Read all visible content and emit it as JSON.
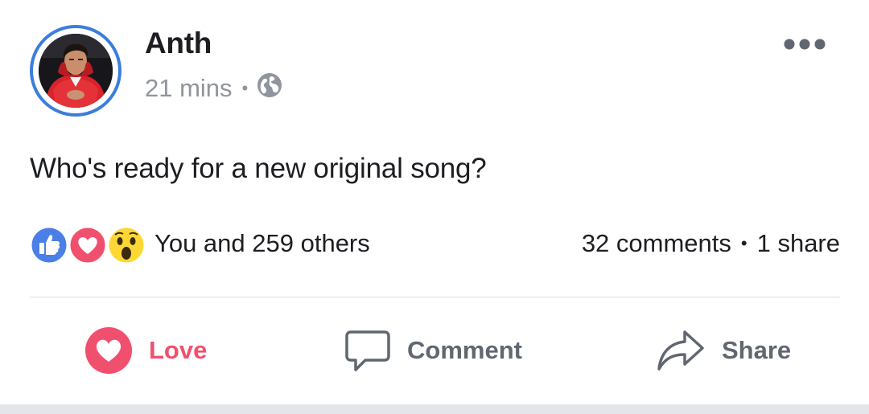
{
  "post": {
    "author": "Anth",
    "time": "21 mins",
    "separator": "•",
    "privacy_icon": "globe-icon",
    "text": "Who's ready for a new original song?",
    "more_icon": "more-options-icon"
  },
  "reactions": {
    "icons": [
      "like-icon",
      "love-icon",
      "wow-icon"
    ],
    "summary": "You and 259 others",
    "comments": "32 comments",
    "separator": "•",
    "shares": "1 share"
  },
  "actions": {
    "love": "Love",
    "comment": "Comment",
    "share": "Share"
  },
  "colors": {
    "like_blue": "#4a7fe8",
    "love_red": "#f0506e",
    "wow_yellow": "#fdd835",
    "ring_blue": "#3b7ddd",
    "text_dark": "#1c1e21",
    "meta_gray": "#90949c",
    "action_gray": "#606770"
  }
}
